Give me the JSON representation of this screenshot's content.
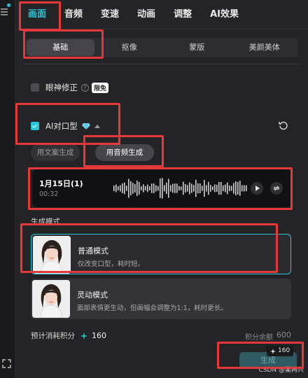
{
  "top_tabs": [
    "画面",
    "音频",
    "变速",
    "动画",
    "调整",
    "AI效果"
  ],
  "sub_tabs": [
    "基础",
    "抠像",
    "蒙版",
    "美颜美体"
  ],
  "eye_correction": {
    "label": "眼神修正",
    "help": "?",
    "badge": "限免"
  },
  "lip_sync": {
    "label": "AI对口型"
  },
  "mode_pills": [
    "用文案生成",
    "用音频生成"
  ],
  "audio": {
    "title": "1月15日(1)",
    "duration": "00:32"
  },
  "generate_mode_label": "生成模式",
  "modes": [
    {
      "title": "普通模式",
      "desc": "仅改变口型，耗时短。"
    },
    {
      "title": "灵动模式",
      "desc": "面部表情更生动，但画幅会调整为1:1，耗时更长。"
    }
  ],
  "cost": {
    "label": "预计消耗积分",
    "value": "160"
  },
  "balance": {
    "label": "积分余额",
    "value": "600"
  },
  "generate": {
    "label": "生成",
    "badge": "160"
  },
  "watermark": "CSDN @案再兴",
  "colors": {
    "accent": "#25c6d9",
    "annotation": "#e5383b"
  }
}
